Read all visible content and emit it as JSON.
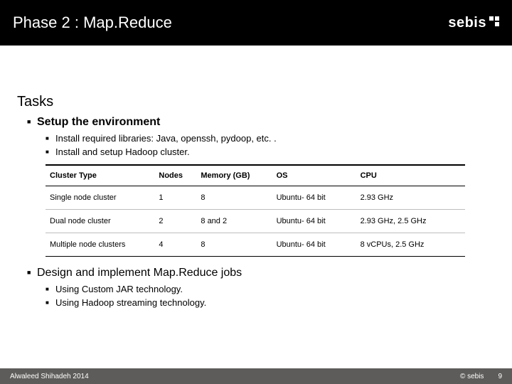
{
  "header": {
    "title": "Phase 2 : Map.Reduce",
    "logo_text": "sebis"
  },
  "content": {
    "section_heading": "Tasks",
    "setup": {
      "label": "Setup the environment",
      "items": [
        "Install required libraries: Java, openssh, pydoop, etc. .",
        "Install and setup Hadoop cluster."
      ]
    },
    "table": {
      "headers": [
        "Cluster Type",
        "Nodes",
        "Memory (GB)",
        "OS",
        "CPU"
      ],
      "rows": [
        [
          "Single node cluster",
          "1",
          "8",
          "Ubuntu- 64 bit",
          "2.93 GHz"
        ],
        [
          "Dual node cluster",
          "2",
          "8 and 2",
          "Ubuntu- 64 bit",
          "2.93 GHz, 2.5 GHz"
        ],
        [
          "Multiple node clusters",
          "4",
          "8",
          "Ubuntu- 64 bit",
          "8 vCPUs, 2.5 GHz"
        ]
      ]
    },
    "design": {
      "label": "Design and implement Map.Reduce jobs",
      "items": [
        "Using Custom JAR technology.",
        "Using Hadoop streaming technology."
      ]
    }
  },
  "footer": {
    "left": "Alwaleed Shihadeh 2014",
    "copyright": "© sebis",
    "page": "9"
  }
}
